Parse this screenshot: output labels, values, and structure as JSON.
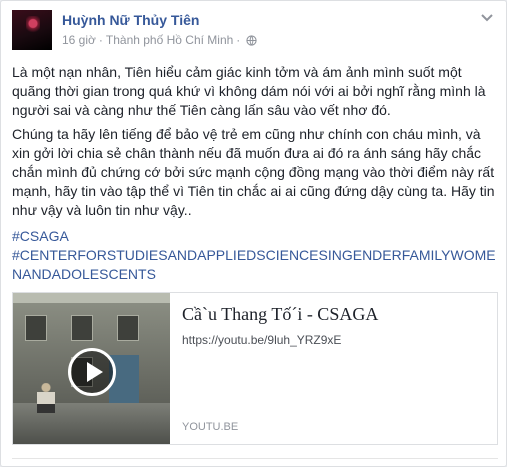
{
  "post": {
    "author": "Huỳnh Nữ Thủy Tiên",
    "time": "16 giờ",
    "separator": "·",
    "location": "Thành phố Hồ Chí Minh",
    "paragraph1": "Là một nạn nhân, Tiên hiểu cảm giác kinh tởm và ám ảnh mình suốt một quãng thời gian trong quá khứ vì không dám nói với ai bởi nghĩ rằng mình là người sai và càng như thế Tiên càng lấn sâu vào vết nhơ đó.",
    "paragraph2": "Chúng ta hãy lên tiếng để bảo vệ trẻ em cũng như chính con cháu mình, và xin gởi lời chia sẻ chân thành nếu đã muốn đưa ai đó ra ánh sáng hãy chắc chắn mình đủ chứng cớ bởi sức mạnh cộng đồng mạng vào thời điểm này rất mạnh, hãy tin vào tập thể vì Tiên tin chắc ai ai cũng đứng dậy cùng ta. Hãy tin như vậy và luôn tin như vậy..",
    "hashtag1": "#CSAGA",
    "hashtag2": "#CENTERFORSTUDIESANDAPPLIEDSCIENCESINGENDERFAMILYWOMENANDADOLESCENTS"
  },
  "shared_link": {
    "title": "Cầ`u Thang Tố´i - CSAGA",
    "url": "https://youtu.be/9luh_YRZ9xE",
    "domain": "YOUTU.BE"
  },
  "icons": {
    "privacy": "globe-icon",
    "menu": "chevron-down-icon",
    "video": "play-icon"
  },
  "colors": {
    "link": "#365899",
    "meta": "#90949c",
    "text": "#1d2129"
  }
}
